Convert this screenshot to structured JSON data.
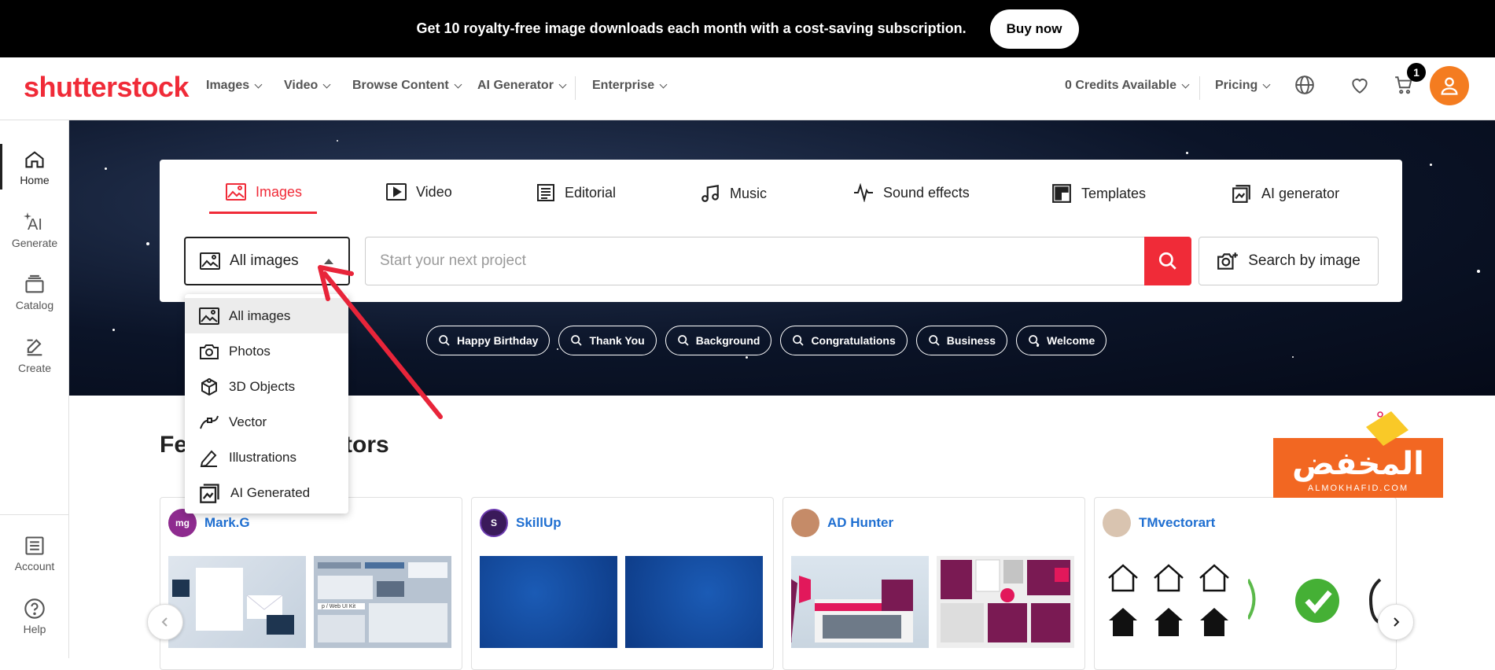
{
  "promo": {
    "text": "Get 10 royalty-free image downloads each month with a cost-saving subscription.",
    "button": "Buy now"
  },
  "header": {
    "logo": "shutterstock",
    "nav": [
      "Images",
      "Video",
      "Browse Content",
      "AI Generator",
      "Enterprise"
    ],
    "credits": "0 Credits Available",
    "pricing": "Pricing",
    "cart_count": "1"
  },
  "rail": {
    "items": [
      {
        "label": "Home",
        "icon": "home-icon"
      },
      {
        "label": "Generate",
        "icon": "ai-sparkle-icon"
      },
      {
        "label": "Catalog",
        "icon": "catalog-icon"
      },
      {
        "label": "Create",
        "icon": "create-icon"
      }
    ],
    "bottom": [
      {
        "label": "Account",
        "icon": "account-list-icon"
      },
      {
        "label": "Help",
        "icon": "help-icon"
      }
    ]
  },
  "search": {
    "tabs": [
      {
        "label": "Images",
        "icon": "image-icon"
      },
      {
        "label": "Video",
        "icon": "video-icon"
      },
      {
        "label": "Editorial",
        "icon": "editorial-icon"
      },
      {
        "label": "Music",
        "icon": "music-icon"
      },
      {
        "label": "Sound effects",
        "icon": "waveform-icon"
      },
      {
        "label": "Templates",
        "icon": "templates-icon"
      },
      {
        "label": "AI generator",
        "icon": "ai-generator-icon"
      }
    ],
    "type_select": "All images",
    "placeholder": "Start your next project",
    "image_search": "Search by image",
    "chips": [
      "Happy Birthday",
      "Thank You",
      "Background",
      "Congratulations",
      "Business",
      "Welcome"
    ]
  },
  "dropdown": {
    "options": [
      {
        "label": "All images",
        "icon": "image-icon"
      },
      {
        "label": "Photos",
        "icon": "camera-icon"
      },
      {
        "label": "3D Objects",
        "icon": "3d-object-icon"
      },
      {
        "label": "Vector",
        "icon": "vector-pen-icon"
      },
      {
        "label": "Illustrations",
        "icon": "illustration-pen-icon"
      },
      {
        "label": "AI Generated",
        "icon": "ai-generated-icon"
      }
    ]
  },
  "featured": {
    "title_left": "Fe",
    "title_right": "tors",
    "cards": [
      {
        "name": "Mark.G",
        "avatar_text": "mg",
        "avatar_color": "#8e2b8f"
      },
      {
        "name": "SkillUp",
        "avatar_text": "S",
        "avatar_color": "#3a1a5a"
      },
      {
        "name": "AD Hunter",
        "avatar_text": "",
        "avatar_color": "#c58b68"
      },
      {
        "name": "TMvectorart",
        "avatar_text": "",
        "avatar_color": "#d9c4b0"
      }
    ]
  },
  "watermark": {
    "arabic": "المخفض",
    "latin": "ALMOKHAFID.COM"
  },
  "colors": {
    "brand": "#f02b38",
    "link": "#1f6fd1",
    "avatar": "#f47c20",
    "annotation": "#e8253a"
  }
}
